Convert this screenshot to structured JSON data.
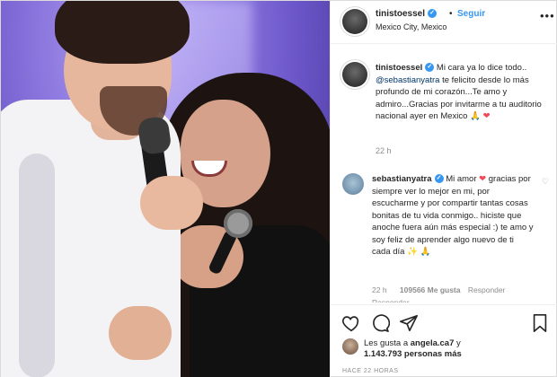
{
  "header": {
    "username": "tinistoessel",
    "separator": "•",
    "follow_label": "Seguir",
    "location": "Mexico City, Mexico",
    "more_icon": "ellipsis-icon"
  },
  "caption": {
    "username": "tinistoessel",
    "text_1": "Mi cara ya lo dice todo..",
    "mention": "@sebastianyatra",
    "text_2": "te felicito desde lo más profundo de mi corazón...Te amo y admiro...Gracias por invitarme a tu auditorio nacional ayer en Mexico",
    "emoji_pray": "🙏",
    "emoji_heart": "❤",
    "time": "22 h"
  },
  "comment": {
    "username": "sebastianyatra",
    "text": "Mi amor",
    "emoji_heart": "❤",
    "text_2": "gracias por siempre ver lo mejor en mi, por escucharme y por compartir tantas cosas bonitas de tu vida conmigo.. hiciste que anoche fuera aún más especial :) te amo y soy feliz de aprender algo nuevo de ti cada día",
    "emoji_end": "✨ 🙏",
    "time": "22 h",
    "likes": "109566 Me gusta",
    "reply_label": "Responder",
    "replies_label": "Responder"
  },
  "likes": {
    "prefix": "Les gusta a",
    "user": "angela.ca7",
    "conj": "y",
    "count": "1.143.793",
    "suffix": "personas más"
  },
  "posted": "HACE 22 HORAS",
  "icons": {
    "like": "heart-icon",
    "comment": "comment-icon",
    "share": "share-icon",
    "save": "bookmark-icon"
  },
  "colors": {
    "accent": "#3897f0",
    "heart": "#ed4956",
    "muted": "#8e8e8e"
  }
}
